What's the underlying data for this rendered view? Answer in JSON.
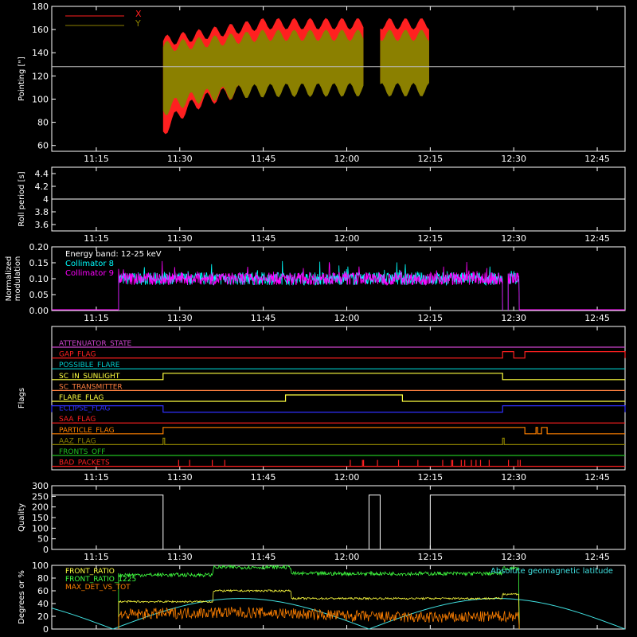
{
  "time_axis": {
    "ticks": [
      "11:15",
      "11:30",
      "11:45",
      "12:00",
      "12:15",
      "12:30",
      "12:45"
    ],
    "range": [
      "11:07",
      "12:50"
    ]
  },
  "chart_data": [
    {
      "type": "area",
      "ylabel": "Pointing [\"]",
      "ylim": [
        55,
        180
      ],
      "yticks": [
        60,
        80,
        100,
        120,
        140,
        160,
        180
      ],
      "reference_line": 128,
      "legend_placement": "top-left",
      "segments": [
        [
          "11:27",
          "12:03"
        ],
        [
          "12:06",
          "12:15"
        ]
      ],
      "series": [
        {
          "name": "X",
          "color": "#ff2020",
          "upper_start": 150,
          "upper_end": 165,
          "lower_start": 72,
          "lower_end": 110
        },
        {
          "name": "Y",
          "color": "#8b8000",
          "upper_start": 145,
          "upper_end": 155,
          "lower_start": 90,
          "lower_end": 108
        }
      ]
    },
    {
      "type": "line",
      "ylabel": "Roll period [s]",
      "ylim": [
        3.5,
        4.5
      ],
      "yticks": [
        3.6,
        3.8,
        4.0,
        4.2,
        4.4
      ],
      "series": [
        {
          "color": "#ffffff",
          "x": [
            "11:07",
            "12:50"
          ],
          "y": [
            4.0,
            4.0
          ]
        }
      ]
    },
    {
      "type": "line",
      "ylabel": "Normalized\nmodulation",
      "ylim": [
        0,
        0.2
      ],
      "yticks": [
        "0.00",
        "0.05",
        "0.10",
        "0.15",
        "0.20"
      ],
      "annotation": "Energy band: 12-25 keV",
      "legend_placement": "top-left",
      "segments": [
        [
          "11:19",
          "12:28"
        ],
        [
          "12:29",
          "12:31"
        ]
      ],
      "series": [
        {
          "name": "Collimator 8",
          "color": "#00ffff",
          "mean": 0.1
        },
        {
          "name": "Collimator 9",
          "color": "#ff00ff",
          "mean": 0.1
        }
      ]
    },
    {
      "type": "line",
      "ylabel": "Flags",
      "flags": [
        {
          "name": "ATTENUATOR_STATE",
          "color": "#cc44cc",
          "on": []
        },
        {
          "name": "GAP_FLAG",
          "color": "#ff2020",
          "on": [
            [
              "12:28",
              "12:30"
            ],
            [
              "12:32",
              "12:50"
            ]
          ]
        },
        {
          "name": "POSSIBLE_FLARE",
          "color": "#00cccc",
          "on": []
        },
        {
          "name": "SC_IN_SUNLIGHT",
          "color": "#ffff40",
          "on": [
            [
              "11:27",
              "12:28"
            ]
          ]
        },
        {
          "name": "SC_TRANSMITTER",
          "color": "#ff8040",
          "on": []
        },
        {
          "name": "FLARE_FLAG",
          "color": "#ffff40",
          "on": [
            [
              "11:49",
              "12:10"
            ]
          ]
        },
        {
          "name": "ECLIPSE_FLAG",
          "color": "#3030ff",
          "on": [
            [
              "11:07",
              "11:27"
            ],
            [
              "12:28",
              "12:50"
            ]
          ]
        },
        {
          "name": "SAA_FLAG",
          "color": "#ff2020",
          "on": []
        },
        {
          "name": "PARTICLE_FLAG",
          "color": "#ff8000",
          "on": [
            [
              "11:27",
              "12:32"
            ],
            [
              "12:34",
              "12:34"
            ],
            [
              "12:35",
              "12:36"
            ]
          ]
        },
        {
          "name": "AAZ_FLAG",
          "color": "#8b8000",
          "on": [
            [
              "11:27",
              "11:27"
            ],
            [
              "12:28",
              "12:28"
            ]
          ]
        },
        {
          "name": "FRONTS_OFF",
          "color": "#20c020",
          "on": []
        },
        {
          "name": "BAD_PACKETS",
          "color": "#ff2020",
          "on": []
        }
      ]
    },
    {
      "type": "line",
      "ylabel": "Quality",
      "ylim": [
        0,
        300
      ],
      "yticks": [
        0,
        50,
        100,
        150,
        200,
        250,
        300
      ],
      "series": [
        {
          "color": "#ffffff",
          "x": [
            "11:07",
            "11:27",
            "11:27",
            "12:04",
            "12:04",
            "12:06",
            "12:06",
            "12:15",
            "12:15",
            "12:50"
          ],
          "y": [
            256,
            256,
            0,
            0,
            256,
            256,
            0,
            0,
            256,
            256
          ]
        }
      ]
    },
    {
      "type": "line",
      "ylabel": "Degrees or %",
      "ylim": [
        0,
        100
      ],
      "yticks": [
        0,
        20,
        40,
        60,
        80,
        100
      ],
      "legend_placement": "top-left",
      "series": [
        {
          "name": "FRONT_RATIO",
          "color": "#ffff40"
        },
        {
          "name": "FRONT_RATIO_1225",
          "color": "#40ff40"
        },
        {
          "name": "MAX_DET_VS_TOT",
          "color": "#ff8000"
        },
        {
          "name": "Absolute geomagnetic latitude",
          "color": "#40e0e0"
        }
      ]
    }
  ]
}
